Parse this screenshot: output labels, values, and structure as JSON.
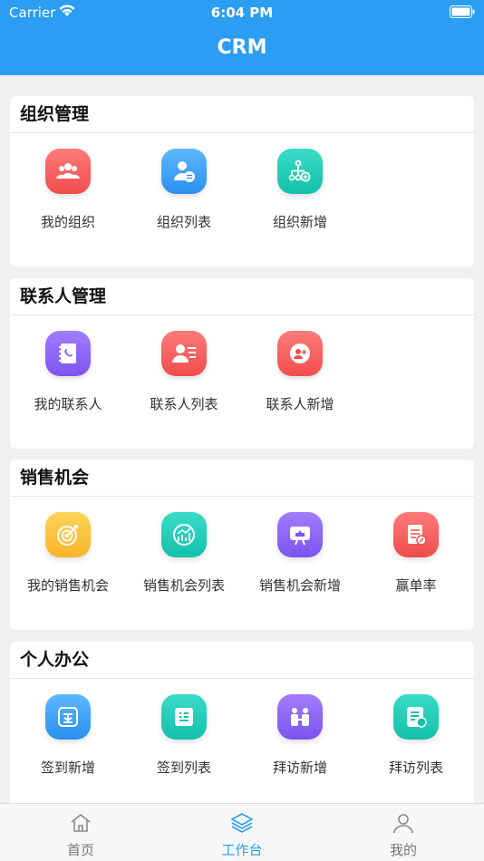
{
  "status": {
    "carrier": "Carrier",
    "time": "6:04 PM"
  },
  "nav": {
    "title": "CRM"
  },
  "sections": [
    {
      "title": "组织管理",
      "items": [
        {
          "label": "我的组织",
          "icon": "group-icon",
          "color": "#f04c4c"
        },
        {
          "label": "组织列表",
          "icon": "user-list-icon",
          "color": "#2b8ff0"
        },
        {
          "label": "组织新增",
          "icon": "org-add-icon",
          "color": "#14c0aa"
        }
      ]
    },
    {
      "title": "联系人管理",
      "items": [
        {
          "label": "我的联系人",
          "icon": "contact-book-icon",
          "color": "#7b54ee"
        },
        {
          "label": "联系人列表",
          "icon": "contact-card-icon",
          "color": "#f04c4c"
        },
        {
          "label": "联系人新增",
          "icon": "contact-add-icon",
          "color": "#f04c4c"
        }
      ]
    },
    {
      "title": "销售机会",
      "items": [
        {
          "label": "我的销售机会",
          "icon": "target-icon",
          "color": "#f8b529"
        },
        {
          "label": "销售机会列表",
          "icon": "chart-icon",
          "color": "#14c0aa"
        },
        {
          "label": "销售机会新增",
          "icon": "presentation-icon",
          "color": "#7b54ee"
        },
        {
          "label": "赢单率",
          "icon": "document-edit-icon",
          "color": "#f04c4c"
        }
      ]
    },
    {
      "title": "个人办公",
      "items": [
        {
          "label": "签到新增",
          "icon": "sign-in-icon",
          "color": "#2b8ff0"
        },
        {
          "label": "签到列表",
          "icon": "list-box-icon",
          "color": "#14c0aa"
        },
        {
          "label": "拜访新增",
          "icon": "visit-add-icon",
          "color": "#7b54ee"
        },
        {
          "label": "拜访列表",
          "icon": "visit-list-icon",
          "color": "#14c0aa"
        }
      ]
    }
  ],
  "tabbar": [
    {
      "label": "首页",
      "icon": "home-icon",
      "active": false
    },
    {
      "label": "工作台",
      "icon": "layers-icon",
      "active": true
    },
    {
      "label": "我的",
      "icon": "profile-icon",
      "active": false
    }
  ]
}
